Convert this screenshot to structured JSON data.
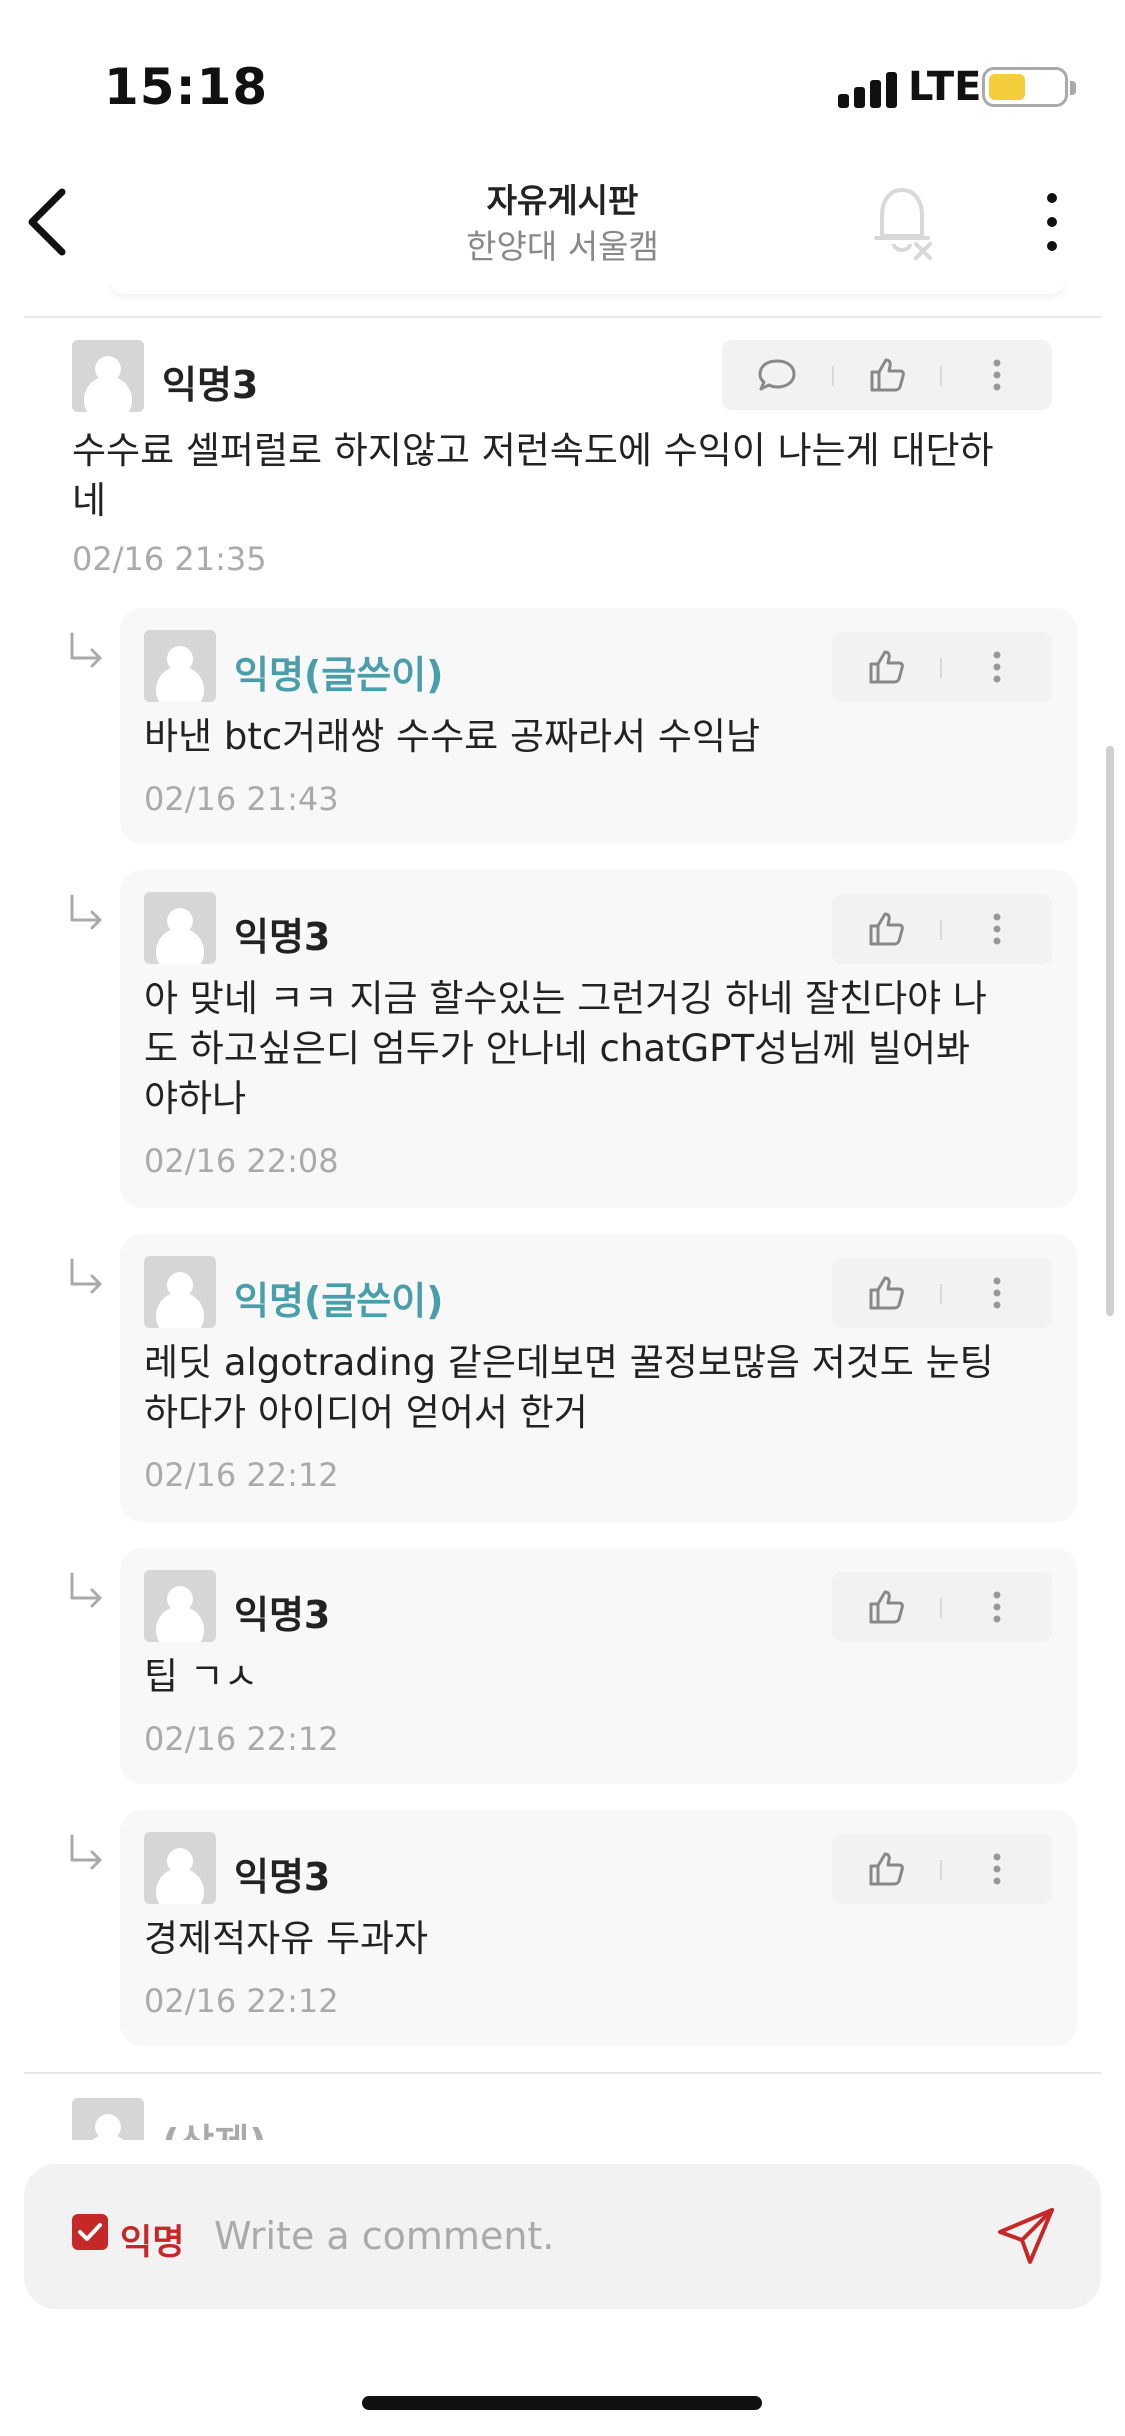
{
  "status_bar": {
    "time": "15:18",
    "network": "LTE"
  },
  "header": {
    "title": "자유게시판",
    "subtitle": "한양대 서울캠"
  },
  "comments": [
    {
      "name": "익명3",
      "text_lines": [
        "수수료 셀퍼럴로 하지않고 저런속도에 수익이 나는게 대단하",
        "네"
      ],
      "time": "02/16 21:35"
    },
    {
      "name": "익명(글쓴이)",
      "text_lines": [
        "바낸 btc거래쌍 수수료 공짜라서 수익남"
      ],
      "time": "02/16 21:43"
    },
    {
      "name": "익명3",
      "text_lines": [
        "아 맞네 ㅋㅋ 지금 할수있는 그런거깅 하네 잘친다야 나",
        "도 하고싶은디 엄두가 안나네 chatGPT성님께 빌어봐",
        "야하나"
      ],
      "time": "02/16 22:08"
    },
    {
      "name": "익명(글쓴이)",
      "text_lines": [
        "레딧 algotrading 같은데보면 꿀정보많음 저것도 눈팅",
        "하다가 아이디어 얻어서 한거"
      ],
      "time": "02/16 22:12"
    },
    {
      "name": "익명3",
      "text_lines": [
        "팁 ㄱㅅ"
      ],
      "time": "02/16 22:12"
    },
    {
      "name": "익명3",
      "text_lines": [
        "경제적자유 두과자"
      ],
      "time": "02/16 22:12"
    },
    {
      "name": "(삭제)"
    }
  ],
  "input": {
    "anonymous_label": "익명",
    "placeholder": "Write a comment."
  },
  "colors": {
    "author": "#4a9eaa",
    "accent": "#c62828",
    "battery": "#f3cd3c"
  },
  "icons": [
    "back-icon",
    "bell-off-icon",
    "more-vertical-icon",
    "comment-icon",
    "thumbs-up-icon",
    "reply-arrow-icon",
    "checkbox-icon",
    "send-icon"
  ]
}
